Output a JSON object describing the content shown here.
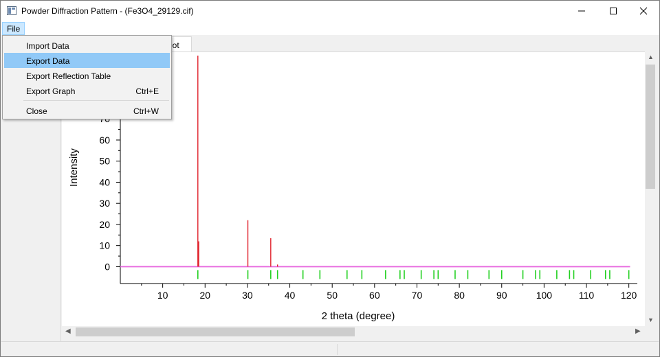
{
  "window": {
    "title": "Powder Diffraction Pattern - (Fe3O4_29129.cif)"
  },
  "menubar": {
    "file_label": "File"
  },
  "file_menu": {
    "items": [
      {
        "label": "Import Data",
        "shortcut": "",
        "highlighted": false
      },
      {
        "label": "Export Data",
        "shortcut": "",
        "highlighted": true
      },
      {
        "label": "Export Reflection Table",
        "shortcut": "",
        "highlighted": false
      },
      {
        "label": "Export Graph",
        "shortcut": "Ctrl+E",
        "highlighted": false
      },
      {
        "label": "Close",
        "shortcut": "Ctrl+W",
        "highlighted": false
      }
    ]
  },
  "tabs": {
    "plot_label": "lot"
  },
  "colors": {
    "pattern": "#e0202a",
    "baseline": "#e86fe0",
    "reflection_ticks": "#22d020",
    "menu_highlight": "#91c9f7"
  },
  "chart_data": {
    "type": "line",
    "xlabel": "2 theta (degree)",
    "ylabel": "Intensity",
    "xlim": [
      0,
      122
    ],
    "ylim": [
      -8,
      100
    ],
    "x_ticks": [
      10,
      20,
      30,
      40,
      50,
      60,
      70,
      80,
      90,
      100,
      110,
      120
    ],
    "y_ticks": [
      0,
      10,
      20,
      30,
      40,
      50,
      60,
      70
    ],
    "series": [
      {
        "values": [
          {
            "x": 18.3,
            "y": 100
          },
          {
            "x": 18.5,
            "y": 12
          },
          {
            "x": 30.1,
            "y": 22
          },
          {
            "x": 35.5,
            "y": 13.5
          },
          {
            "x": 37.1,
            "y": 1
          }
        ]
      }
    ],
    "reflections": [
      18.3,
      30.1,
      35.5,
      37.1,
      43.1,
      47.1,
      53.5,
      57.0,
      62.6,
      66.0,
      67.0,
      71.0,
      74.0,
      75.0,
      79.0,
      82.0,
      87.0,
      90.0,
      95.0,
      98.0,
      99.0,
      103.0,
      106.0,
      107.0,
      111.0,
      114.5,
      115.5,
      120.0
    ]
  }
}
